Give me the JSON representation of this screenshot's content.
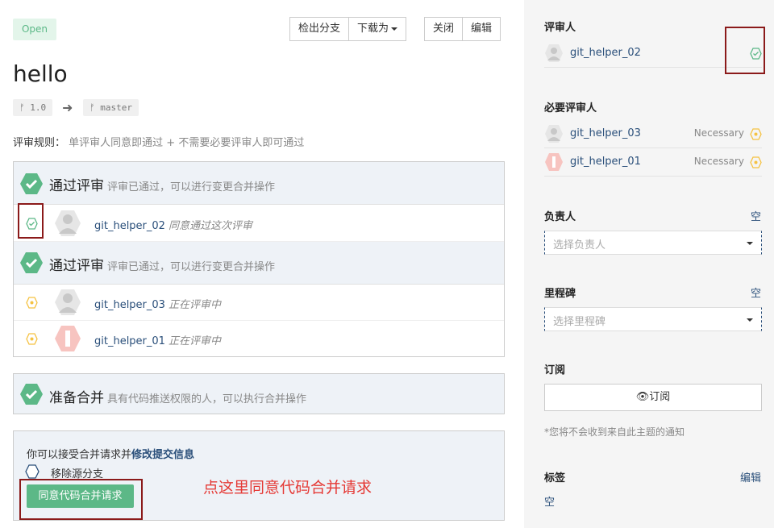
{
  "status_badge": "Open",
  "toolbar": {
    "checkout_label": "检出分支",
    "download_label": "下载为",
    "close_label": "关闭",
    "edit_label": "编辑"
  },
  "title": "hello",
  "branches": {
    "source": "1.0",
    "target": "master"
  },
  "rule": {
    "label": "评审规则：",
    "value": "单评审人同意即通过 + 不需要必要评审人即可通过"
  },
  "review_groups": [
    {
      "title": "通过评审",
      "subtitle": "评审已通过，可以进行变更合并操作",
      "rows": [
        {
          "name": "git_helper_02",
          "note": "同意通过这次评审",
          "state": "approved"
        }
      ]
    },
    {
      "title": "通过评审",
      "subtitle": "评审已通过，可以进行变更合并操作",
      "rows": [
        {
          "name": "git_helper_03",
          "note": "正在评审中",
          "state": "pending"
        },
        {
          "name": "git_helper_01",
          "note": "正在评审中",
          "state": "pending"
        }
      ]
    }
  ],
  "merge_ready": {
    "title": "准备合并",
    "subtitle": "具有代码推送权限的人，可以执行合并操作"
  },
  "accept": {
    "text": "你可以接受合并请求并",
    "link": "修改提交信息",
    "remove_branch": "移除源分支",
    "button": "同意代码合并请求"
  },
  "annotation": "点这里同意代码合并请求",
  "sidebar": {
    "reviewers_heading": "评审人",
    "reviewers": [
      {
        "name": "git_helper_02"
      }
    ],
    "required_heading": "必要评审人",
    "required": [
      {
        "name": "git_helper_03",
        "tag": "Necessary"
      },
      {
        "name": "git_helper_01",
        "tag": "Necessary"
      }
    ],
    "assignee_heading": "负责人",
    "assignee_value": "空",
    "assignee_placeholder": "选择负责人",
    "milestone_heading": "里程碑",
    "milestone_value": "空",
    "milestone_placeholder": "选择里程碑",
    "subscribe_heading": "订阅",
    "subscribe_button": "订阅",
    "subscribe_note": "*您将不会收到来自此主题的通知",
    "labels_heading": "标签",
    "labels_edit": "编辑",
    "labels_value": "空"
  },
  "colors": {
    "accent_green": "#5cb887",
    "pending_yellow": "#f5c242",
    "annotation_red": "#e53935",
    "highlight_border": "#8b1a1a"
  }
}
